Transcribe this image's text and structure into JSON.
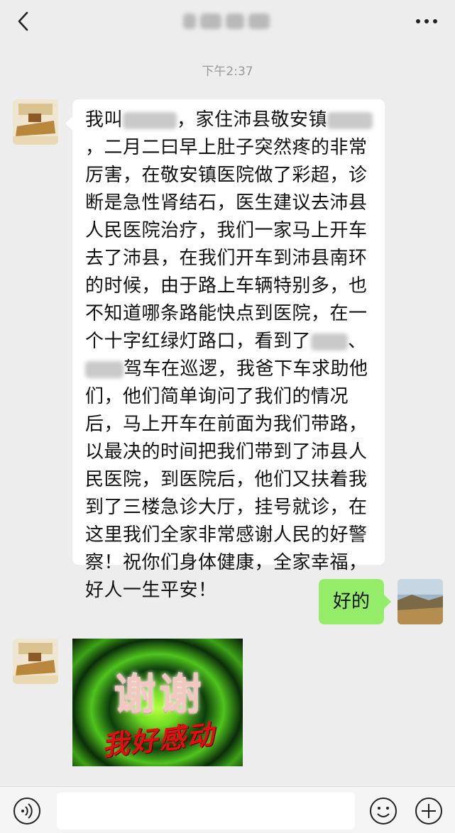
{
  "header": {
    "back_icon": "chevron-left-icon",
    "more_icon": "ellipsis-icon"
  },
  "chat": {
    "timestamp": "下午2:37",
    "incoming_message_parts": [
      "我叫",
      "，家住沛县敬安镇",
      "，二月二曰早上肚子突然疼的非常厉害，在敬安镇医院做了彩超，诊断是急性肾结石，医生建议去沛县人民医院治疗，我们一家马上开车去了沛县，在我们开车到沛县南环的时候，由于路上车辆特别多，也不知道哪条路能快点到医院，在一个十字红绿灯路口，看到了",
      "、",
      "驾车在巡逻，我爸下车求助他们，他们简单询问了我们的情况后，马上开车在前面为我们带路，以最决的时间把我们带到了沛县人民医院，到医院后，他们又扶着我到了三楼急诊大厅，挂号就诊，在这里我们全家非常感谢人民的好警察！祝你们身体健康，全家幸福，好人一生平安！"
    ],
    "outgoing_message": "好的",
    "sticker_main_text": "谢谢",
    "sticker_sub_text": "我好感动"
  },
  "input_bar": {
    "voice_icon": "voice-icon",
    "emoji_icon": "emoji-icon",
    "plus_icon": "plus-icon"
  },
  "colors": {
    "background": "#ededed",
    "outgoing_bubble": "#95ec69",
    "incoming_bubble": "#ffffff"
  }
}
